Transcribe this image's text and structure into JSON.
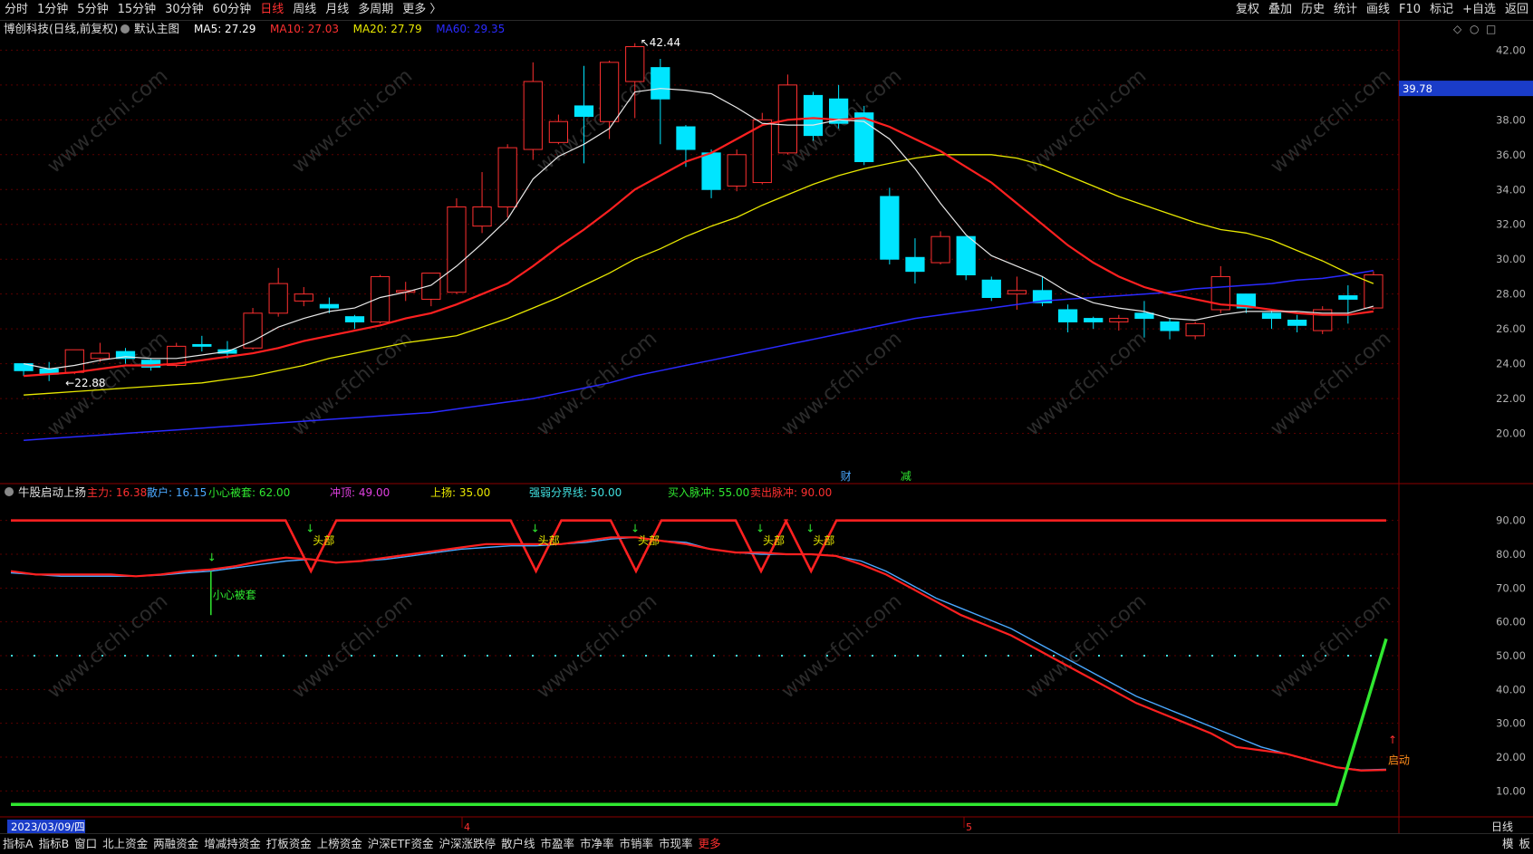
{
  "toolbar": {
    "periods": [
      "分时",
      "1分钟",
      "5分钟",
      "15分钟",
      "30分钟",
      "60分钟",
      "日线",
      "周线",
      "月线",
      "多周期",
      "更多 〉"
    ],
    "active_period": "日线",
    "right_buttons": [
      "复权",
      "叠加",
      "历史",
      "统计",
      "画线",
      "F10",
      "标记",
      "+自选",
      "返回"
    ]
  },
  "main_panel": {
    "title": "博创科技(日线,前复权)",
    "subtitle": "默认主图",
    "ma_labels": [
      {
        "text": "MA5: 27.29",
        "color": "#ffffff"
      },
      {
        "text": "MA10: 27.03",
        "color": "#ff3030"
      },
      {
        "text": "MA20: 27.79",
        "color": "#e8e800"
      },
      {
        "text": "MA60: 29.35",
        "color": "#2a2aff"
      }
    ],
    "current_price_tag": "39.78",
    "high_marker": "42.44",
    "low_marker": "22.88",
    "event_markers": [
      "财",
      "减"
    ]
  },
  "indicator_panel": {
    "title": "牛股启动上扬",
    "labels": [
      {
        "text": "主力: 16.38",
        "color": "#ff3030"
      },
      {
        "text": "散户: 16.15",
        "color": "#4aa8ff"
      },
      {
        "text": "小心被套: 62.00",
        "color": "#30e830"
      },
      {
        "text": "冲顶: 49.00",
        "color": "#e040e0"
      },
      {
        "text": "上扬: 35.00",
        "color": "#e8e800"
      },
      {
        "text": "强弱分界线: 50.00",
        "color": "#40e0e0"
      },
      {
        "text": "买入脉冲: 55.00",
        "color": "#30e830"
      },
      {
        "text": "卖出脉冲: 90.00",
        "color": "#ff3030"
      }
    ],
    "signal_head": "头部",
    "signal_careful": "小心被套",
    "signal_launch": "启动"
  },
  "axis": {
    "date_label": "2023/03/09/四",
    "month_labels": [
      "4",
      "5"
    ],
    "period_label": "日线"
  },
  "bottom_tabs": [
    "指标A",
    "指标B",
    "窗口",
    "北上资金",
    "两融资金",
    "增减持资金",
    "打板资金",
    "上榜资金",
    "沪深ETF资金",
    "沪深涨跌停",
    "散户线",
    "市盈率",
    "市净率",
    "市销率",
    "市现率",
    "更多"
  ],
  "bottom_active": "更多",
  "bottom_right": [
    "模",
    "板"
  ],
  "chart_data": {
    "type": "candlestick",
    "price_axis": {
      "ticks": [
        20,
        22,
        24,
        26,
        28,
        30,
        32,
        34,
        36,
        38,
        40,
        42
      ],
      "labels": [
        "20.00",
        "22.00",
        "24.00",
        "26.00",
        "28.00",
        "30.00",
        "32.00",
        "34.00",
        "36.00",
        "38.00",
        "40.00",
        "42.00"
      ],
      "range": [
        19.3,
        42.8
      ]
    },
    "candles": [
      [
        24.0,
        23.6,
        24.0,
        23.3
      ],
      [
        23.7,
        23.4,
        24.1,
        23.0
      ],
      [
        23.5,
        24.8,
        24.8,
        23.4
      ],
      [
        24.3,
        24.6,
        25.2,
        24.1
      ],
      [
        24.7,
        24.3,
        24.9,
        24.0
      ],
      [
        24.2,
        23.8,
        24.3,
        23.6
      ],
      [
        23.9,
        25.0,
        25.2,
        23.8
      ],
      [
        25.1,
        25.0,
        25.6,
        24.7
      ],
      [
        24.8,
        24.6,
        25.3,
        24.3
      ],
      [
        24.9,
        26.9,
        27.2,
        24.8
      ],
      [
        26.9,
        28.6,
        29.5,
        26.7
      ],
      [
        27.6,
        28.0,
        28.4,
        27.3
      ],
      [
        27.4,
        27.2,
        27.8,
        26.9
      ],
      [
        26.7,
        26.4,
        26.8,
        26.0
      ],
      [
        26.4,
        29.0,
        29.1,
        26.3
      ],
      [
        28.1,
        28.2,
        28.7,
        27.6
      ],
      [
        27.7,
        29.2,
        29.2,
        27.3
      ],
      [
        28.1,
        33.0,
        33.5,
        28.0
      ],
      [
        31.9,
        33.0,
        35.0,
        31.5
      ],
      [
        33.0,
        36.4,
        36.6,
        32.4
      ],
      [
        36.3,
        40.2,
        41.3,
        35.7
      ],
      [
        36.7,
        37.9,
        38.3,
        36.6
      ],
      [
        38.8,
        38.2,
        41.1,
        35.5
      ],
      [
        37.9,
        41.3,
        41.4,
        36.9
      ],
      [
        40.2,
        42.2,
        42.4,
        38.1
      ],
      [
        41.0,
        39.2,
        41.5,
        36.6
      ],
      [
        37.6,
        36.3,
        37.7,
        35.3
      ],
      [
        36.1,
        34.0,
        36.3,
        33.5
      ],
      [
        34.2,
        36.0,
        36.3,
        33.9
      ],
      [
        34.4,
        38.0,
        38.4,
        34.3
      ],
      [
        36.1,
        40.0,
        40.6,
        36.0
      ],
      [
        39.4,
        37.1,
        39.6,
        36.8
      ],
      [
        39.2,
        37.8,
        40.0,
        37.5
      ],
      [
        38.4,
        35.6,
        38.8,
        35.4
      ],
      [
        33.6,
        30.0,
        34.1,
        29.7
      ],
      [
        30.1,
        29.3,
        31.2,
        28.6
      ],
      [
        29.8,
        31.3,
        31.6,
        29.7
      ],
      [
        31.3,
        29.1,
        31.3,
        28.8
      ],
      [
        28.8,
        27.8,
        29.0,
        27.6
      ],
      [
        28.0,
        28.2,
        29.0,
        27.1
      ],
      [
        28.2,
        27.5,
        29.0,
        27.3
      ],
      [
        27.1,
        26.4,
        27.4,
        25.8
      ],
      [
        26.6,
        26.4,
        26.7,
        26.0
      ],
      [
        26.4,
        26.6,
        26.8,
        25.9
      ],
      [
        26.9,
        26.6,
        27.6,
        25.5
      ],
      [
        26.4,
        25.9,
        26.6,
        25.4
      ],
      [
        25.6,
        26.3,
        26.4,
        25.4
      ],
      [
        27.1,
        29.0,
        29.6,
        26.9
      ],
      [
        28.0,
        27.2,
        28.0,
        26.9
      ],
      [
        26.9,
        26.6,
        27.1,
        26.0
      ],
      [
        26.5,
        26.2,
        26.8,
        25.8
      ],
      [
        25.9,
        27.1,
        27.3,
        25.7
      ],
      [
        27.9,
        27.7,
        28.5,
        26.3
      ],
      [
        27.2,
        29.1,
        29.3,
        27.1
      ]
    ],
    "ma5": [
      24.0,
      23.7,
      23.9,
      24.2,
      24.4,
      24.3,
      24.3,
      24.5,
      24.7,
      25.3,
      26.1,
      26.6,
      27.0,
      27.2,
      27.8,
      28.1,
      28.5,
      29.6,
      30.9,
      32.3,
      34.6,
      35.9,
      36.6,
      37.5,
      39.6,
      39.8,
      39.7,
      39.5,
      38.7,
      37.8,
      37.7,
      37.7,
      38.0,
      37.9,
      36.9,
      35.2,
      33.2,
      31.4,
      30.2,
      29.6,
      29.0,
      28.1,
      27.5,
      27.2,
      27.0,
      26.6,
      26.5,
      26.8,
      27.0,
      27.0,
      27.0,
      26.9,
      26.9,
      27.3
    ],
    "ma10": [
      23.3,
      23.4,
      23.5,
      23.7,
      23.9,
      23.9,
      24.0,
      24.2,
      24.4,
      24.6,
      24.9,
      25.3,
      25.6,
      25.9,
      26.2,
      26.6,
      26.9,
      27.4,
      28.0,
      28.6,
      29.6,
      30.7,
      31.7,
      32.8,
      34.0,
      34.8,
      35.6,
      36.1,
      36.9,
      37.7,
      38.0,
      38.1,
      38.0,
      38.1,
      37.6,
      36.9,
      36.2,
      35.3,
      34.4,
      33.2,
      32.0,
      30.8,
      29.8,
      29.0,
      28.4,
      28.0,
      27.7,
      27.4,
      27.3,
      27.1,
      26.9,
      26.8,
      26.8,
      27.0
    ],
    "ma20": [
      22.2,
      22.3,
      22.4,
      22.5,
      22.6,
      22.7,
      22.8,
      22.9,
      23.1,
      23.3,
      23.6,
      23.9,
      24.3,
      24.6,
      24.9,
      25.2,
      25.4,
      25.6,
      26.1,
      26.6,
      27.2,
      27.8,
      28.5,
      29.2,
      30.0,
      30.6,
      31.3,
      31.9,
      32.4,
      33.1,
      33.7,
      34.3,
      34.8,
      35.2,
      35.5,
      35.8,
      36.0,
      36.0,
      36.0,
      35.8,
      35.4,
      34.8,
      34.2,
      33.6,
      33.1,
      32.6,
      32.1,
      31.7,
      31.5,
      31.1,
      30.5,
      29.9,
      29.2,
      28.6
    ],
    "ma60": [
      19.6,
      19.7,
      19.8,
      19.9,
      20.0,
      20.1,
      20.2,
      20.3,
      20.4,
      20.5,
      20.6,
      20.7,
      20.8,
      20.9,
      21.0,
      21.1,
      21.2,
      21.4,
      21.6,
      21.8,
      22.0,
      22.3,
      22.6,
      22.9,
      23.3,
      23.6,
      23.9,
      24.2,
      24.5,
      24.8,
      25.1,
      25.4,
      25.7,
      26.0,
      26.3,
      26.6,
      26.8,
      27.0,
      27.2,
      27.4,
      27.6,
      27.7,
      27.8,
      27.9,
      28.0,
      28.1,
      28.3,
      28.4,
      28.5,
      28.6,
      28.8,
      28.9,
      29.1,
      29.35
    ],
    "indicator_axis": {
      "ticks": [
        10,
        20,
        30,
        40,
        50,
        60,
        70,
        80,
        90
      ],
      "labels": [
        "10.00",
        "20.00",
        "30.00",
        "40.00",
        "50.00",
        "60.00",
        "70.00",
        "80.00",
        "90.00"
      ],
      "range": [
        5,
        95
      ]
    },
    "main_force": [
      75,
      74,
      74,
      74,
      74,
      73.5,
      74,
      75,
      75.5,
      76.5,
      78,
      79,
      78.5,
      77.5,
      78,
      79,
      80,
      81,
      82,
      83,
      83,
      83,
      83,
      84,
      85,
      85,
      84,
      83,
      81.5,
      80.5,
      80.5,
      80,
      80,
      79.5,
      77,
      74,
      70,
      66,
      62,
      59,
      56,
      52,
      48,
      44,
      40,
      36,
      33,
      30,
      27,
      23,
      22,
      21,
      19,
      17,
      16,
      16.2
    ],
    "retail": [
      74.5,
      74,
      73.5,
      73.5,
      73.5,
      73.5,
      73.8,
      74.5,
      75,
      76,
      77,
      78,
      78.5,
      77.5,
      78,
      78.5,
      79.5,
      80.5,
      81.5,
      82,
      82.5,
      82.5,
      83,
      83.5,
      84.5,
      85,
      84,
      83.5,
      81.5,
      80.5,
      80,
      80,
      80,
      79.5,
      78,
      75,
      71,
      67,
      64,
      61,
      58,
      54,
      50,
      46,
      42,
      38,
      35,
      32,
      29,
      26,
      23,
      21,
      19,
      17,
      16.2,
      16.4
    ],
    "sell_pulse_index": [
      12,
      21,
      25,
      30,
      32
    ],
    "buy_pulse": {
      "base": 6,
      "end_value": 55
    }
  }
}
